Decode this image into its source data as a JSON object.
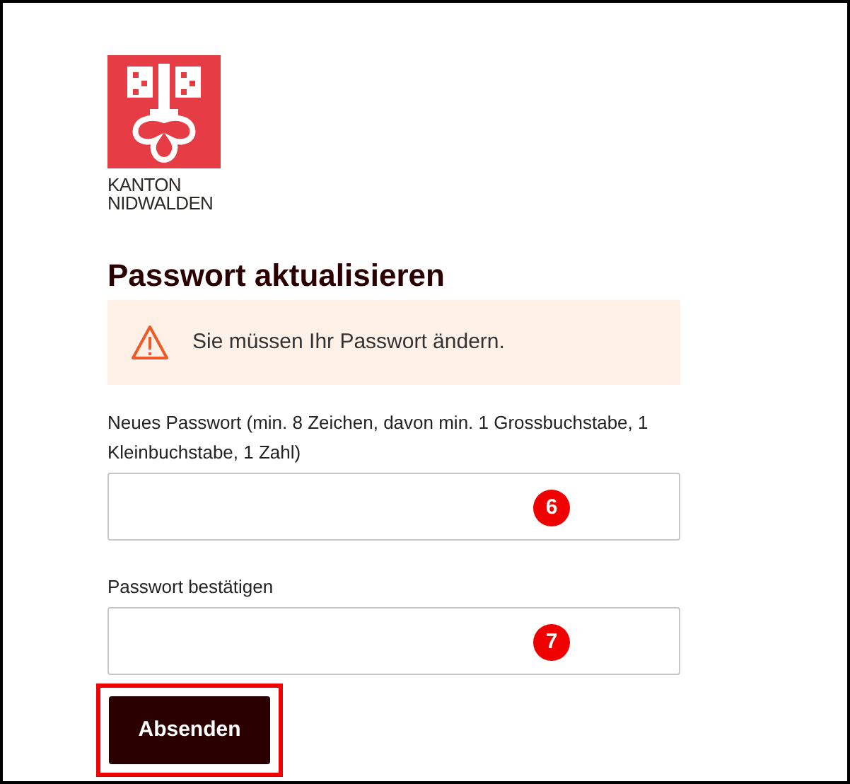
{
  "logo": {
    "lines": [
      "KANTON",
      "NIDWALDEN"
    ]
  },
  "heading": "Passwort aktualisieren",
  "alert": {
    "message": "Sie müssen Ihr Passwort ändern."
  },
  "fields": [
    {
      "label": "Neues Passwort (min. 8 Zeichen, davon min. 1 Grossbuchstabe, 1 Kleinbuchstabe, 1 Zahl)",
      "marker": "6"
    },
    {
      "label": "Passwort bestätigen",
      "marker": "7"
    }
  ],
  "submit": {
    "label": "Absenden",
    "highlighted": true
  }
}
